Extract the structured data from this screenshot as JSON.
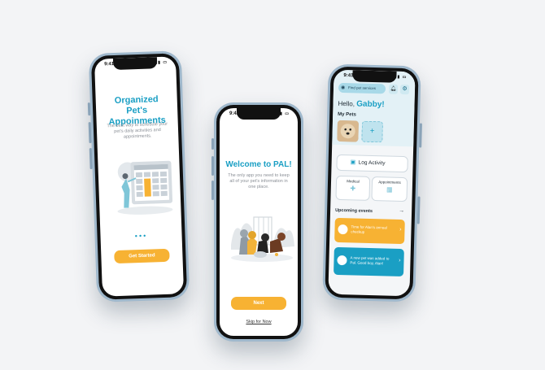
{
  "colors": {
    "accent": "#1a9fc4",
    "button": "#f7b233",
    "frame": "#9fb8cc"
  },
  "phone1": {
    "status_time": "9:41",
    "title": "Organized Pet's Appoinments",
    "subtitle": "The best way to schedule your pet's daily activities and appointments.",
    "cta": "Get Started"
  },
  "phone2": {
    "status_time": "9:41",
    "title": "Welcome to PAL!",
    "subtitle": "The only app you need to keep all of your pet's information in one place.",
    "cta": "Next",
    "skip": "Skip for Now"
  },
  "phone3": {
    "status_time": "9:41",
    "search_placeholder": "Find pet services",
    "greeting_prefix": "Hello,",
    "greeting_name": "Gabby!",
    "my_pets": "My Pets",
    "log_activity": "Log Activity",
    "tile_medical": "Medical",
    "tile_appointments": "Appointments",
    "upcoming": "Upcoming events",
    "events": [
      {
        "text": "Time for Alan's annual checkup"
      },
      {
        "text": "A new pet was added to Pal. Good boy, Alan!"
      }
    ]
  }
}
